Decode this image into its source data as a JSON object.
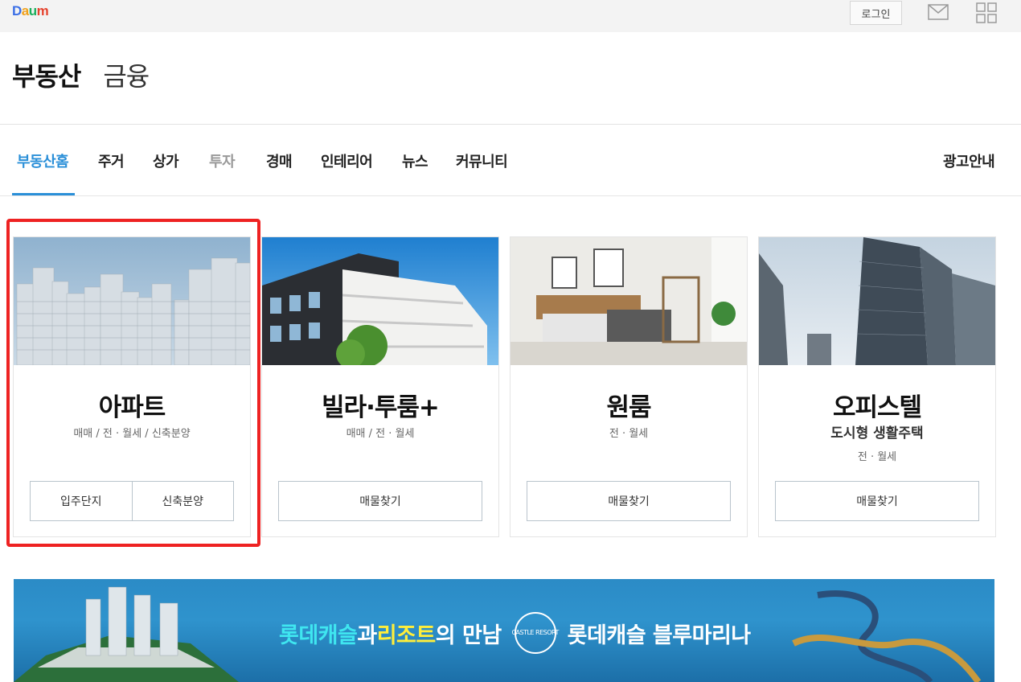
{
  "topbar": {
    "logo_parts": [
      "D",
      "a",
      "u",
      "m"
    ],
    "login_label": "로그인"
  },
  "sections": [
    {
      "label": "부동산",
      "active": true
    },
    {
      "label": "금융",
      "active": false
    }
  ],
  "nav": {
    "items": [
      "부동산홈",
      "주거",
      "상가",
      "투자",
      "경매",
      "인테리어",
      "뉴스",
      "커뮤니티"
    ],
    "right_link": "광고안내",
    "active_index": 0,
    "accent_color": "#2a8fd8"
  },
  "cards": [
    {
      "title": "아파트",
      "subtitle": "",
      "meta": "매매 / 전 · 월세 / 신축분양",
      "buttons": [
        "입주단지",
        "신축분양"
      ],
      "highlighted": true
    },
    {
      "title": "빌라·투룸+",
      "subtitle": "",
      "meta": "매매 / 전 · 월세",
      "buttons": [
        "매물찾기"
      ]
    },
    {
      "title": "원룸",
      "subtitle": "",
      "meta": "전 · 월세",
      "buttons": [
        "매물찾기"
      ]
    },
    {
      "title": "오피스텔",
      "subtitle": "도시형 생활주택",
      "meta": "전 · 월세",
      "buttons": [
        "매물찾기"
      ]
    }
  ],
  "banner": {
    "part1": "롯데캐슬",
    "part2": "과 ",
    "part3": "리조트",
    "part4": "의 만남",
    "badge": "CASTLE RESORT",
    "part5": "롯데캐슬 블루마리나"
  },
  "highlight_color": "#ee2222"
}
